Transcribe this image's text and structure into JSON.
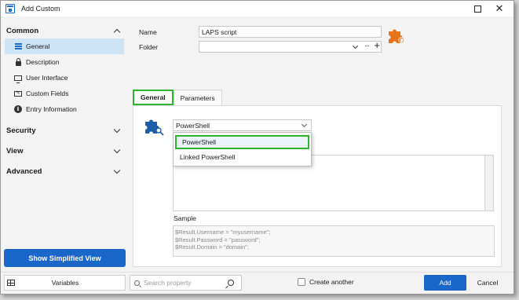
{
  "window": {
    "title": "Add Custom"
  },
  "sidebar": {
    "sections": [
      {
        "label": "Common",
        "expanded": true
      },
      {
        "label": "Security",
        "expanded": false
      },
      {
        "label": "View",
        "expanded": false
      },
      {
        "label": "Advanced",
        "expanded": false
      }
    ],
    "items": [
      {
        "label": "General",
        "icon": "list-icon",
        "selected": true
      },
      {
        "label": "Description",
        "icon": "lock-icon"
      },
      {
        "label": "User Interface",
        "icon": "monitor-icon"
      },
      {
        "label": "Custom Fields",
        "icon": "field-icon"
      },
      {
        "label": "Entry Information",
        "icon": "info-icon"
      }
    ],
    "simplified_button": "Show Simplified View"
  },
  "form": {
    "name_label": "Name",
    "name_value": "LAPS script",
    "folder_label": "Folder",
    "folder_value": ""
  },
  "tabs": [
    {
      "label": "General",
      "active": true
    },
    {
      "label": "Parameters",
      "active": false
    }
  ],
  "general": {
    "script_type_selected": "PowerShell",
    "dropdown_options": [
      "PowerShell",
      "Linked PowerShell"
    ],
    "sample_label": "Sample",
    "sample_lines": [
      "$Result.Username = \"myusername\";",
      "$Result.Password = \"password\";",
      "$Result.Domain = \"domain\";"
    ]
  },
  "bottom": {
    "variables_label": "Variables",
    "search_placeholder": "Search property",
    "create_another_label": "Create another",
    "create_another_checked": false,
    "add_label": "Add",
    "cancel_label": "Cancel"
  },
  "colors": {
    "accent_blue": "#1a66c9",
    "highlight_green": "#2db52d",
    "selected_bg": "#cde4f7",
    "entry_icon_orange": "#e8731c",
    "ps_icon_blue": "#1c5fa8"
  }
}
